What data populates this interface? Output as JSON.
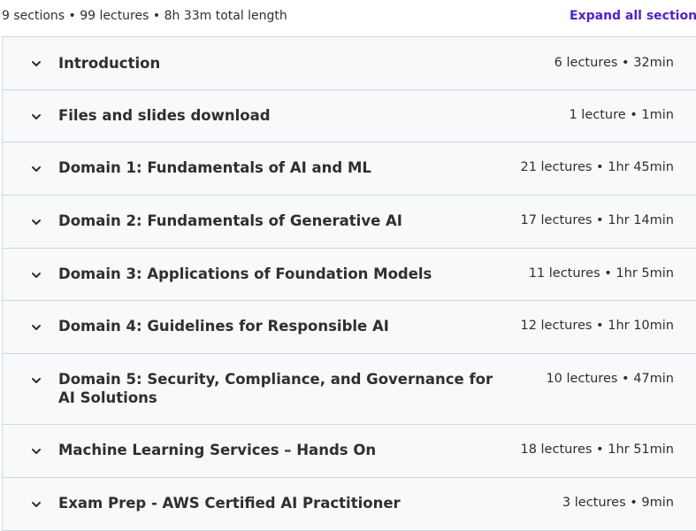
{
  "header": {
    "summary": "9 sections • 99 lectures • 8h 33m total length",
    "expand_label": "Expand all sections"
  },
  "sections": [
    {
      "title": "Introduction",
      "meta": "6 lectures • 32min"
    },
    {
      "title": "Files and slides download",
      "meta": "1 lecture • 1min"
    },
    {
      "title": "Domain 1: Fundamentals of AI and ML",
      "meta": "21 lectures • 1hr 45min"
    },
    {
      "title": "Domain 2: Fundamentals of Generative AI",
      "meta": "17 lectures • 1hr 14min"
    },
    {
      "title": "Domain 3: Applications of Foundation Models",
      "meta": "11 lectures • 1hr 5min"
    },
    {
      "title": "Domain 4: Guidelines for Responsible AI",
      "meta": "12 lectures • 1hr 10min"
    },
    {
      "title": "Domain 5: Security, Compliance, and Governance for AI Solutions",
      "meta": "10 lectures • 47min"
    },
    {
      "title": "Machine Learning Services – Hands On",
      "meta": "18 lectures • 1hr 51min"
    },
    {
      "title": "Exam Prep - AWS Certified AI Practitioner",
      "meta": "3 lectures • 9min"
    }
  ],
  "colors": {
    "accent": "#5022c3",
    "section_bg": "#f7f9fa",
    "border": "#d1d7dc",
    "text": "#2d2f31"
  },
  "icons": {
    "chevron": "chevron-down-icon"
  }
}
